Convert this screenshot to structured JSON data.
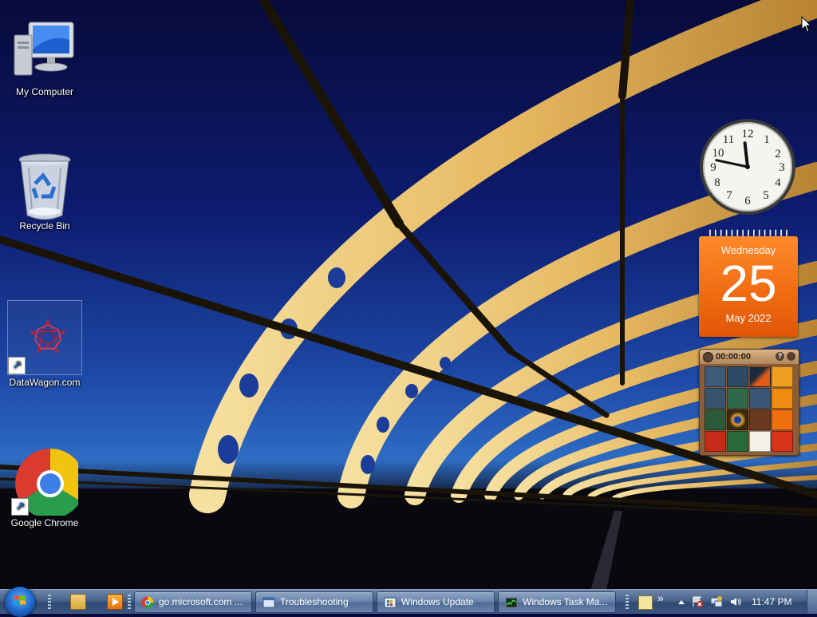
{
  "desktop": {
    "icons": [
      {
        "label": "My Computer",
        "icon": "computer-icon"
      },
      {
        "label": "Recycle Bin",
        "icon": "recycle-bin-icon"
      },
      {
        "label": "DataWagon.com",
        "icon": "datawagon-icon"
      },
      {
        "label": "Google Chrome",
        "icon": "chrome-icon"
      }
    ]
  },
  "gadgets": {
    "clock": {
      "hour": 11,
      "minute": 47
    },
    "calendar": {
      "weekday": "Wednesday",
      "day": "25",
      "month_year": "May 2022"
    },
    "puzzle": {
      "timer": "00:00:00",
      "help": "?"
    }
  },
  "taskbar": {
    "quick_launch": [
      "explorer-icon",
      "media-player-icon"
    ],
    "buttons": [
      {
        "label": "go.microsoft.com ...",
        "icon": "chrome-icon"
      },
      {
        "label": "Troubleshooting",
        "icon": "troubleshooting-icon"
      },
      {
        "label": "Windows Update",
        "icon": "windows-update-icon"
      },
      {
        "label": "Windows Task Ma...",
        "icon": "task-manager-icon"
      }
    ],
    "overflow": "»",
    "tray_icons": [
      "notes-icon",
      "show-hidden-icons-icon",
      "action-center-icon",
      "network-icon",
      "volume-icon"
    ],
    "time": "11:47 PM"
  },
  "colors": {
    "taskbar": "#3a5680",
    "calendar": "#ef6a10",
    "accent": "#1c64c8"
  }
}
